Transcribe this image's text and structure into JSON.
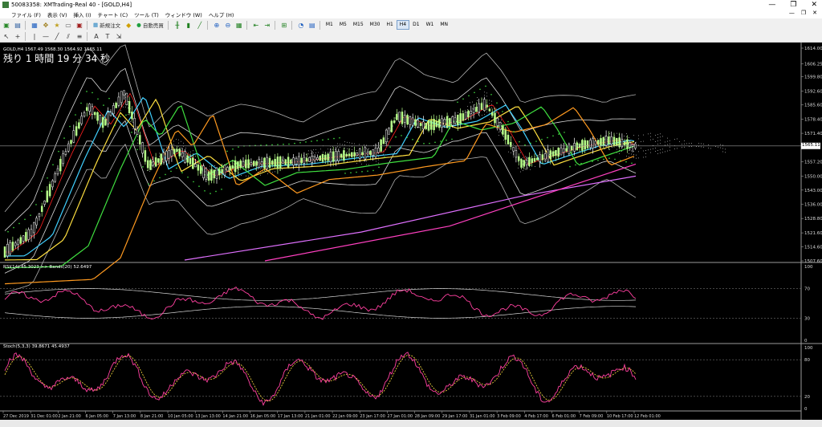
{
  "window": {
    "title": "50083358: XMTrading-Real 40 - [GOLD,H4]",
    "min": "—",
    "max": "❐",
    "close": "✕"
  },
  "menu": [
    "ファイル (F)",
    "表示 (V)",
    "挿入 (I)",
    "チャート (C)",
    "ツール (T)",
    "ウィンドウ (W)",
    "ヘルプ (H)"
  ],
  "mdi": {
    "min": "—",
    "restore": "❐",
    "close": "✕"
  },
  "toolbar": {
    "new_order": "新規注文",
    "auto_trade": "自動売買"
  },
  "timeframes": [
    "M1",
    "M5",
    "M15",
    "M30",
    "H1",
    "H4",
    "D1",
    "W1",
    "MN"
  ],
  "selected_timeframe": "H4",
  "main_chart": {
    "header": "GOLD,H4  1567.49 1568.30 1564.92 1565.11",
    "countdown": "残り 1 時間 19 分 34 秒",
    "current_price": "1565.11",
    "price_labels": [
      "1614.00",
      "1606.25",
      "1599.80",
      "1592.60",
      "1585.60",
      "1578.40",
      "1571.40",
      "1564.10",
      "1557.20",
      "1550.00",
      "1543.00",
      "1536.00",
      "1528.80",
      "1521.60",
      "1514.60",
      "1507.60"
    ]
  },
  "rsi_panel": {
    "header": "RSI(14) 45.3023  >> Bands(20) 52.6497",
    "levels": [
      "100",
      "70",
      "30",
      "0"
    ]
  },
  "stoch_panel": {
    "header": "Stoch(5,3,3) 39.8671 45.4937",
    "levels": [
      "100",
      "80",
      "20",
      "0"
    ]
  },
  "time_labels": [
    "27 Dec 2019",
    "31 Dec 01:00",
    "2 Jan 21:00",
    "6 Jan 05:00",
    "7 Jan 13:00",
    "8 Jan 21:00",
    "10 Jan 05:00",
    "13 Jan 13:00",
    "14 Jan 21:00",
    "16 Jan 05:00",
    "17 Jan 13:00",
    "21 Jan 01:00",
    "22 Jan 09:00",
    "23 Jan 17:00",
    "27 Jan 01:00",
    "28 Jan 09:00",
    "29 Jan 17:00",
    "31 Jan 01:00",
    "3 Feb 09:00",
    "4 Feb 17:00",
    "6 Feb 01:00",
    "7 Feb 09:00",
    "10 Feb 17:00",
    "12 Feb 01:00"
  ],
  "colors": {
    "background": "#000000",
    "candle_up": "#b8ff8a",
    "candle_down": "#ffffff",
    "ma_red": "#ff2020",
    "ma_yellow": "#ffe040",
    "ma_orange": "#ff9a20",
    "ma_green": "#40e040",
    "ma_cyan": "#40d0ff",
    "ma_magenta": "#ff40c0",
    "ma_violet": "#e070ff",
    "rsi": "#ff40a0",
    "stoch_signal": "#ffe040"
  }
}
